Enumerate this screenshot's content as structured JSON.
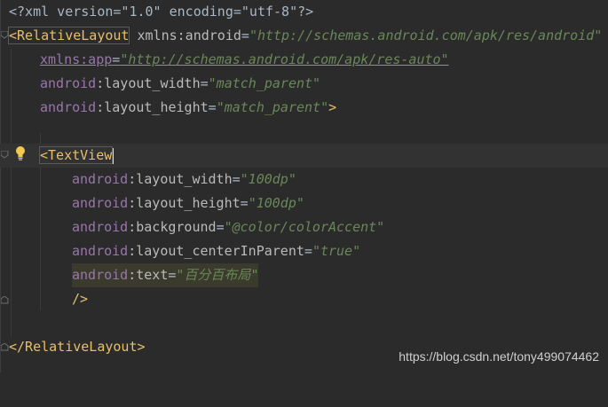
{
  "editor": {
    "lines": [
      {
        "text": "<?xml version=\"1.0\" encoding=\"utf-8\"?>"
      },
      {
        "tag_open": "<RelativeLayout",
        "attr_ns": "xmlns:android",
        "eq": "=",
        "value": "\"http://schemas.android.com/apk/res/android\""
      },
      {
        "attr_ns": "xmlns:app",
        "eq": "=",
        "value": "\"http://schemas.android.com/apk/res-auto\""
      },
      {
        "ns": "android",
        "attr": ":layout_width",
        "eq": "=",
        "value": "\"match_parent\""
      },
      {
        "ns": "android",
        "attr": ":layout_height",
        "eq": "=",
        "value": "\"match_parent\"",
        "close": ">"
      },
      {
        "blank": ""
      },
      {
        "tag_open": "<TextView"
      },
      {
        "ns": "android",
        "attr": ":layout_width",
        "eq": "=",
        "value": "\"100dp\""
      },
      {
        "ns": "android",
        "attr": ":layout_height",
        "eq": "=",
        "value": "\"100dp\""
      },
      {
        "ns": "android",
        "attr": ":background",
        "eq": "=",
        "value": "\"@color/colorAccent\""
      },
      {
        "ns": "android",
        "attr": ":layout_centerInParent",
        "eq": "=",
        "value": "\"true\""
      },
      {
        "ns": "android",
        "attr": ":text",
        "eq": "=",
        "value": "\"百分百布局\""
      },
      {
        "close": "/>"
      },
      {
        "blank": ""
      },
      {
        "tag_close": "</RelativeLayout>"
      }
    ]
  },
  "icons": {
    "intention": "lightbulb-icon",
    "fold": "fold-marker-icon"
  },
  "watermark": "https://blog.csdn.net/tony499074462"
}
